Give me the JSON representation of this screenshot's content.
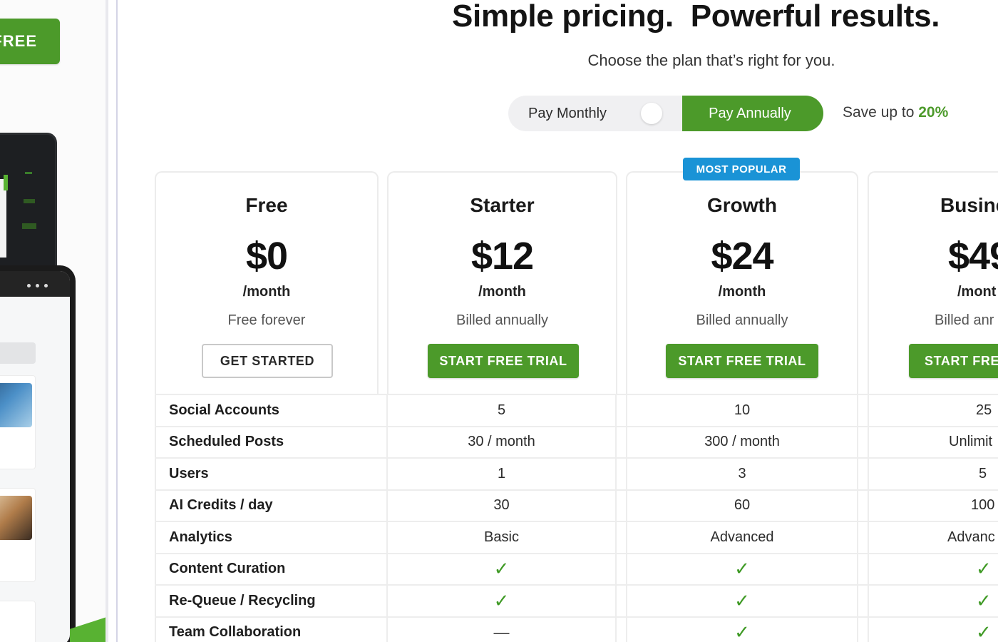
{
  "left_promo": {
    "cta_label": "FREE"
  },
  "header": {
    "title": "Simple pricing.  Powerful results.",
    "subtitle": "Choose the plan that’s right for you."
  },
  "billing_toggle": {
    "monthly_label": "Pay Monthly",
    "annual_label": "Pay Annually",
    "selected": "annual",
    "save_prefix": "Save up to ",
    "save_value": "20%"
  },
  "badge": {
    "label": "MOST POPULAR"
  },
  "plans": [
    {
      "name": "Free",
      "price": "$0",
      "period": "/month",
      "note": "Free forever",
      "button": "GET STARTED"
    },
    {
      "name": "Starter",
      "price": "$12",
      "period": "/month",
      "note": "Billed annually",
      "button": "START FREE TRIAL"
    },
    {
      "name": "Growth",
      "price": "$24",
      "period": "/month",
      "note": "Billed annually",
      "button": "START FREE TRIAL"
    },
    {
      "name": "Busine",
      "price": "$49",
      "period": "/mont",
      "note": "Billed anr",
      "button": "START FREE"
    }
  ],
  "features": [
    {
      "label": "Social Accounts",
      "values": [
        "5",
        "10",
        "25"
      ]
    },
    {
      "label": "Scheduled Posts",
      "values": [
        "30 / month",
        "300 / month",
        "Unlimit"
      ]
    },
    {
      "label": "Users",
      "values": [
        "1",
        "3",
        "5"
      ]
    },
    {
      "label": "AI Credits / day",
      "values": [
        "30",
        "60",
        "100"
      ]
    },
    {
      "label": "Analytics",
      "values": [
        "Basic",
        "Advanced",
        "Advanc"
      ]
    },
    {
      "label": "Content Curation",
      "values": [
        "check",
        "check",
        "check"
      ]
    },
    {
      "label": "Re-Queue / Recycling",
      "values": [
        "check",
        "check",
        "check"
      ]
    },
    {
      "label": "Team Collaboration",
      "values": [
        "dash",
        "check",
        "check"
      ]
    }
  ],
  "colors": {
    "brand_green": "#4c9a2a",
    "badge_blue": "#1a93d6",
    "check_green": "#3f9a25"
  },
  "icons": {
    "check": "check-icon",
    "dash": "dash-icon"
  }
}
